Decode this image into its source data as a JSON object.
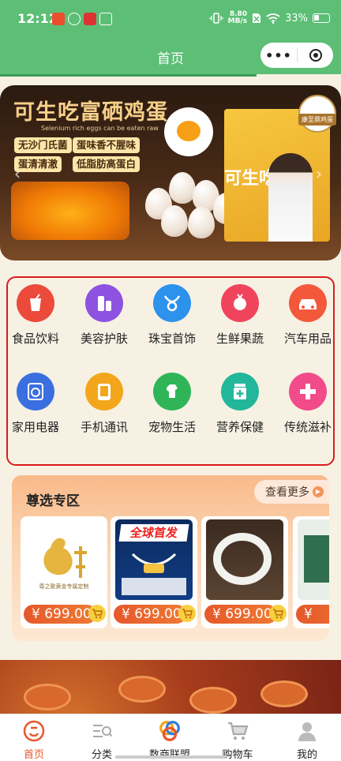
{
  "status_bar": {
    "time": "12:12",
    "net_speed_value": "8.80",
    "net_speed_unit": "MB/s",
    "battery": "33%"
  },
  "header": {
    "title": "首页",
    "capsule_more": "•••"
  },
  "banner": {
    "title": "可生吃富硒鸡蛋",
    "subtitle": "Selenium rich eggs can be eaten raw",
    "tags": [
      "无沙门氏菌",
      "蛋味香不腥味",
      "蛋清清澈",
      "低脂肪高蛋白"
    ],
    "box_label": "可生吃",
    "brand": "康至鼎鸡蛋"
  },
  "categories": [
    {
      "label": "食品饮料",
      "icon": "drink-cup-icon",
      "color": "#ec4a3b"
    },
    {
      "label": "美容护肤",
      "icon": "cosmetics-icon",
      "color": "#8d53e0"
    },
    {
      "label": "珠宝首饰",
      "icon": "necklace-icon",
      "color": "#2c92ec"
    },
    {
      "label": "生鲜果蔬",
      "icon": "vegetable-icon",
      "color": "#f0445d"
    },
    {
      "label": "汽车用品",
      "icon": "car-icon",
      "color": "#f4583b"
    },
    {
      "label": "家用电器",
      "icon": "washing-machine-icon",
      "color": "#3a6fe0"
    },
    {
      "label": "手机通讯",
      "icon": "tablet-icon",
      "color": "#f3a61c"
    },
    {
      "label": "宠物生活",
      "icon": "dog-icon",
      "color": "#2fb557"
    },
    {
      "label": "营养保健",
      "icon": "medicine-bottle-icon",
      "color": "#22b79a"
    },
    {
      "label": "传统滋补",
      "icon": "health-cross-icon",
      "color": "#f24b8a"
    }
  ],
  "featured": {
    "title": "尊选专区",
    "see_more": "查看更多",
    "products": [
      {
        "price": "¥ 699.00",
        "caption": "尊之歌黄金专属定制"
      },
      {
        "price": "¥ 699.00",
        "caption": "全球首发"
      },
      {
        "price": "¥ 699.00",
        "caption": ""
      },
      {
        "price": "¥",
        "caption": ""
      }
    ]
  },
  "tabs": [
    {
      "label": "首页",
      "icon": "home-logo-icon",
      "active": true
    },
    {
      "label": "分类",
      "icon": "category-search-icon",
      "active": false
    },
    {
      "label": "数商联盟",
      "icon": "alliance-logo-icon",
      "active": false
    },
    {
      "label": "购物车",
      "icon": "cart-icon",
      "active": false
    },
    {
      "label": "我的",
      "icon": "user-icon",
      "active": false
    }
  ]
}
